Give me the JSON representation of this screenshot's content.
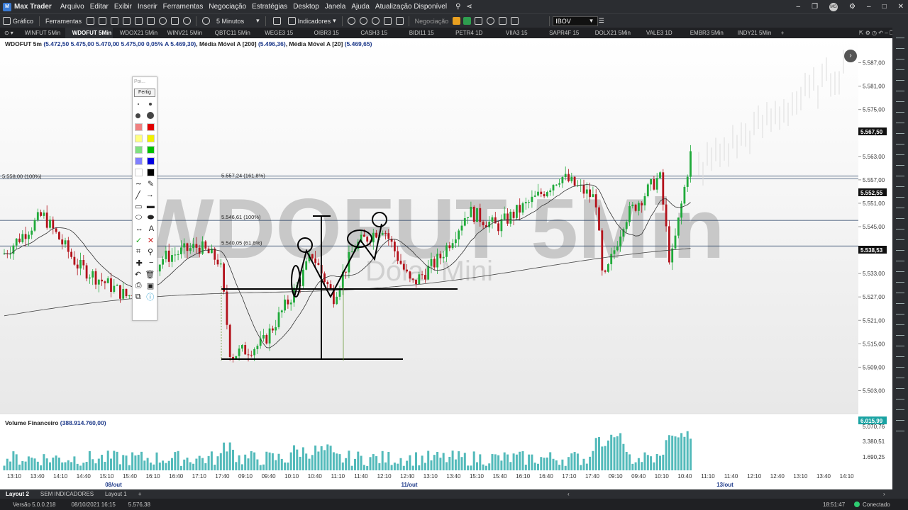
{
  "app": {
    "name": "Max Trader",
    "menus": [
      "Arquivo",
      "Editar",
      "Exibir",
      "Inserir",
      "Ferramentas",
      "Negociação",
      "Estratégias",
      "Desktop",
      "Janela",
      "Ajuda",
      "Atualização Disponível"
    ],
    "user_initials": "MG"
  },
  "toolbar": {
    "grafico": "Gráfico",
    "ferramentas": "Ferramentas",
    "timeframe": "5 Minutos",
    "indicadores": "Indicadores",
    "negociacao": "Negociação",
    "asset_value": "IBOV"
  },
  "tabs": [
    {
      "label": "WINFUT 5Min"
    },
    {
      "label": "WDOFUT 5Min",
      "active": true
    },
    {
      "label": "WDOX21 5Min"
    },
    {
      "label": "WINV21 5Min"
    },
    {
      "label": "QBTC11 5Min"
    },
    {
      "label": "WEGE3 15"
    },
    {
      "label": "OIBR3 15"
    },
    {
      "label": "CASH3 15"
    },
    {
      "label": "BIDI11 15"
    },
    {
      "label": "PETR4 1D"
    },
    {
      "label": "VIIA3 15"
    },
    {
      "label": "SAPR4F 15"
    },
    {
      "label": "DOLX21 5Min"
    },
    {
      "label": "VALE3 1D"
    },
    {
      "label": "EMBR3 5Min"
    },
    {
      "label": "INDY21 5Min"
    }
  ],
  "chart": {
    "info_symbol": "WDOFUT 5m",
    "info_values": "(5.472,50  5.475,00  5.470,00  5.475,00  0,05%  A 5.469,30)",
    "ma200_label": "Média Móvel A [200]",
    "ma200_value": "(5.496,36)",
    "ma20_label": "Média Móvel A [20]",
    "ma20_value": "(5.469,65)",
    "watermark_title": "WDOFUT 5Min",
    "watermark_subtitle": "Dólar Mini",
    "fib_left_label": "5.558,00 (100%)",
    "fib_labels": [
      "5.557,24 (161,8%)",
      "5.546,61 (100%)",
      "5.540,05 (61,8%)"
    ],
    "price_ticks": [
      "5.587,00",
      "5.581,00",
      "5.575,00",
      "5.569,00",
      "5.563,00",
      "5.557,00",
      "5.551,00",
      "5.545,00",
      "5.539,00",
      "5.533,00",
      "5.527,00",
      "5.521,00",
      "5.515,00",
      "5.509,00",
      "5.503,00"
    ],
    "last_price_tag": "5.567,50",
    "tag_2": "5.552,55",
    "tag_3": "5.538,53",
    "time_ticks": [
      "13:10",
      "13:40",
      "14:10",
      "14:40",
      "15:10",
      "15:40",
      "16:10",
      "16:40",
      "17:10",
      "17:40",
      "09:10",
      "09:40",
      "10:10",
      "10:40",
      "11:10",
      "11:40",
      "12:10",
      "12:40",
      "13:10",
      "13:40",
      "15:10",
      "15:40",
      "16:10",
      "16:40",
      "17:10",
      "17:40",
      "09:10",
      "09:40",
      "10:10",
      "10:40",
      "11:10",
      "11:40",
      "12:10",
      "12:40",
      "13:10",
      "13:40",
      "14:10"
    ],
    "date_labels": [
      "08/out",
      "11/out",
      "13/out"
    ],
    "volume_title": "Volume Financeiro",
    "volume_value": "(388.914.760,00)",
    "volume_ticks": [
      "6.015,99",
      "5.070,76",
      "3.380,51",
      "1.690,25"
    ]
  },
  "palette": {
    "search_placeholder": "Poi...",
    "done_label": "Fertig",
    "colors": [
      "#f08080",
      "#e00000",
      "#ffff80",
      "#f0f000",
      "#80e080",
      "#00c000",
      "#8080ff",
      "#0000e0",
      "#ffffff",
      "#000000"
    ]
  },
  "bottom": {
    "tabs": [
      "Layout 2",
      "SEM INDICADORES",
      "Layout 1"
    ],
    "version": "Versão 5.0.0.218",
    "datetime": "08/10/2021 16:15",
    "price": "5.576,38",
    "clock": "18:51:47",
    "status": "Conectado"
  },
  "colors": {
    "up_candle": "#1faa3a",
    "down_candle": "#b3121b",
    "volume": "#1aa3a3",
    "ma_line": "#333333"
  }
}
